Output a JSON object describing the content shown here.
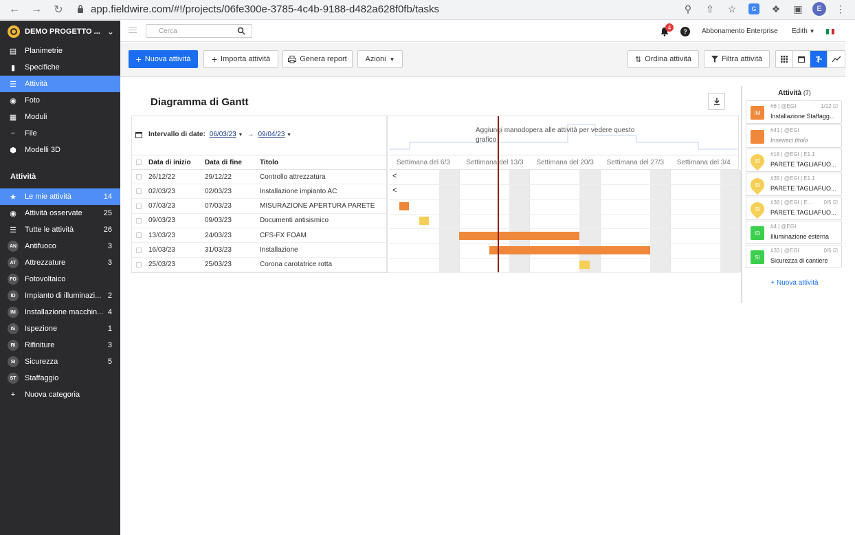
{
  "browser": {
    "url": "app.fieldwire.com/#!/projects/06fe300e-3785-4c4b-9188-d482a628f0fb/tasks",
    "profile_initial": "E"
  },
  "sidebar": {
    "project_name": "DEMO PROGETTO ...",
    "nav": [
      {
        "label": "Planimetrie",
        "icon": "map-icon"
      },
      {
        "label": "Specifiche",
        "icon": "book-icon"
      },
      {
        "label": "Attività",
        "icon": "list-icon"
      },
      {
        "label": "Foto",
        "icon": "camera-icon"
      },
      {
        "label": "Moduli",
        "icon": "forms-icon"
      },
      {
        "label": "File",
        "icon": "paperclip-icon"
      },
      {
        "label": "Modelli 3D",
        "icon": "cube-icon"
      }
    ],
    "section_title": "Attività",
    "categories": [
      {
        "badge": "",
        "icon": "star-icon",
        "label": "Le mie attività",
        "count": "14"
      },
      {
        "badge": "",
        "icon": "eye-icon",
        "label": "Attività osservate",
        "count": "25"
      },
      {
        "badge": "",
        "icon": "list-icon",
        "label": "Tutte le attività",
        "count": "26"
      },
      {
        "badge": "AN",
        "label": "Antifuoco",
        "count": "3"
      },
      {
        "badge": "AT",
        "label": "Attrezzature",
        "count": "3"
      },
      {
        "badge": "FO",
        "label": "Fotovoltaico",
        "count": ""
      },
      {
        "badge": "ID",
        "label": "Impianto di illuminazi...",
        "count": "2"
      },
      {
        "badge": "IM",
        "label": "Installazione macchin...",
        "count": "4"
      },
      {
        "badge": "IS",
        "label": "Ispezione",
        "count": "1"
      },
      {
        "badge": "RI",
        "label": "Rifiniture",
        "count": "3"
      },
      {
        "badge": "SI",
        "label": "Sicurezza",
        "count": "5"
      },
      {
        "badge": "ST",
        "label": "Staffaggio",
        "count": ""
      },
      {
        "badge": "",
        "icon": "plus-icon",
        "label": "Nuova categoria",
        "count": ""
      }
    ]
  },
  "topbar": {
    "search_placeholder": "Cerca",
    "notifications": "4",
    "help": "?",
    "plan": "Abbonamento Enterprise",
    "user": "Edith"
  },
  "toolbar": {
    "new_task": "Nuova attività",
    "import": "Importa attività",
    "report": "Genera report",
    "actions": "Azioni",
    "sort": "Ordina attività",
    "filter": "Filtra attività"
  },
  "gantt": {
    "title": "Diagramma di Gantt",
    "range_label": "Intervallo di date:",
    "range_start": "06/03/23",
    "range_end": "09/04/23",
    "labor_msg": "Aggiungi manodopera alle attività per vedere questo grafico",
    "columns": [
      "Data di inizio",
      "Data di fine",
      "Titolo"
    ],
    "weeks": [
      "Settimana del 6/3",
      "Settimana del 13/3",
      "Settimana del 20/3",
      "Settimana del 27/3",
      "Settimana del 3/4"
    ],
    "rows": [
      {
        "start": "26/12/22",
        "end": "29/12/22",
        "title": "Controllo attrezzatura"
      },
      {
        "start": "02/03/23",
        "end": "02/03/23",
        "title": "Installazione impianto AC"
      },
      {
        "start": "07/03/23",
        "end": "07/03/23",
        "title": "MISURAZIONE APERTURA PARETE"
      },
      {
        "start": "09/03/23",
        "end": "09/03/23",
        "title": "Documenti antisismico"
      },
      {
        "start": "13/03/23",
        "end": "24/03/23",
        "title": "CFS-FX FOAM"
      },
      {
        "start": "16/03/23",
        "end": "31/03/23",
        "title": "Installazione"
      },
      {
        "start": "25/03/23",
        "end": "25/03/23",
        "title": "Corona carotatrice rotta"
      }
    ],
    "out_of_range_marker": "<",
    "colors": {
      "orange": "#f0883a",
      "yellow": "#f6cf57",
      "today": "#8a1c1c"
    }
  },
  "panel": {
    "title": "Attività",
    "count": "(7)",
    "cards": [
      {
        "badge": "IM",
        "shape": "square",
        "color": "#f0883a",
        "meta": "#6 | @EGI",
        "meta_right": "1/12",
        "title": "Installazione Staffagg...",
        "italic": false
      },
      {
        "badge": "",
        "shape": "square",
        "color": "#f0883a",
        "meta": "#41 | @EGI",
        "meta_right": "",
        "title": "Inserisci titolo",
        "italic": true
      },
      {
        "badge": "SI",
        "shape": "pin",
        "color": "#f6cf57",
        "meta": "#18 | @EGI | E1.1",
        "meta_right": "",
        "title": "PARETE TAGLIAFUO...",
        "italic": false
      },
      {
        "badge": "SI",
        "shape": "pin",
        "color": "#f6cf57",
        "meta": "#35 | @EGI | E1.1",
        "meta_right": "",
        "title": "PARETE TAGLIAFUO...",
        "italic": false
      },
      {
        "badge": "SI",
        "shape": "pin",
        "color": "#f6cf57",
        "meta": "#36 | @EGI | E...",
        "meta_right": "0/5",
        "title": "PARETE TAGLIAFUO...",
        "italic": false
      },
      {
        "badge": "ID",
        "shape": "square",
        "color": "#3ccf4e",
        "meta": "#4 | @EGI",
        "meta_right": "",
        "title": "Illuminazione esterna",
        "italic": false
      },
      {
        "badge": "SI",
        "shape": "square",
        "color": "#3ccf4e",
        "meta": "#33 | @EGI",
        "meta_right": "0/5",
        "title": "Sicurezza di cantiere",
        "italic": false
      }
    ],
    "new_task": "+ Nuova attività"
  }
}
